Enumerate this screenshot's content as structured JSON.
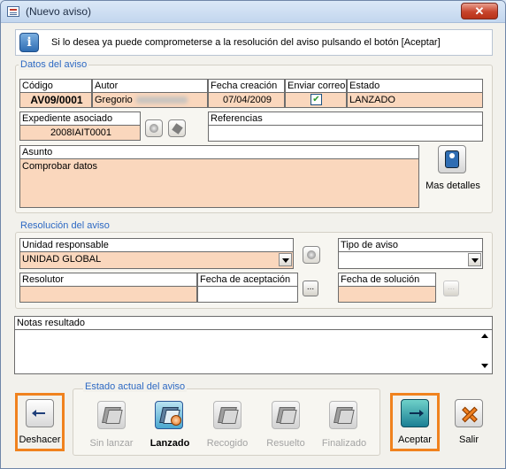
{
  "window": {
    "title": "(Nuevo aviso)",
    "close_label": "✕"
  },
  "info": {
    "icon": "info-icon",
    "message": "Si lo desea ya puede comprometerse a la resolución del aviso pulsando el botón [Aceptar]"
  },
  "datos": {
    "group_label": "Datos del aviso",
    "headers": {
      "codigo": "Código",
      "autor": "Autor",
      "fecha": "Fecha creación",
      "enviar": "Enviar correo",
      "estado": "Estado"
    },
    "values": {
      "codigo": "AV09/0001",
      "autor": "Gregorio",
      "fecha": "07/04/2009",
      "enviar_checked": true,
      "estado": "LANZADO"
    },
    "expediente_label": "Expediente asociado",
    "expediente_value": "2008IAIT0001",
    "referencias_label": "Referencias",
    "referencias_value": "",
    "asunto_label": "Asunto",
    "asunto_value": "Comprobar datos",
    "mas_detalles": "Mas detalles"
  },
  "resolucion": {
    "group_label": "Resolución del aviso",
    "unidad_label": "Unidad responsable",
    "unidad_value": "UNIDAD GLOBAL",
    "tipo_label": "Tipo de aviso",
    "tipo_value": "",
    "resolutor_label": "Resolutor",
    "resolutor_value": "",
    "fecha_aceptacion_label": "Fecha de aceptación",
    "fecha_aceptacion_value": "",
    "fecha_solucion_label": "Fecha de solución",
    "fecha_solucion_value": "",
    "dots": "..."
  },
  "notas": {
    "label": "Notas resultado",
    "value": ""
  },
  "estado_actual": {
    "group_label": "Estado actual del aviso",
    "states": [
      {
        "label": "Sin lanzar",
        "active": false
      },
      {
        "label": "Lanzado",
        "active": true
      },
      {
        "label": "Recogido",
        "active": false
      },
      {
        "label": "Resuelto",
        "active": false
      },
      {
        "label": "Finalizado",
        "active": false
      }
    ]
  },
  "buttons": {
    "deshacer": "Deshacer",
    "aceptar": "Aceptar",
    "salir": "Salir"
  },
  "colors": {
    "highlight": "#f0821e",
    "group_label": "#2d69c3",
    "field_peach": "#fad7bd"
  }
}
